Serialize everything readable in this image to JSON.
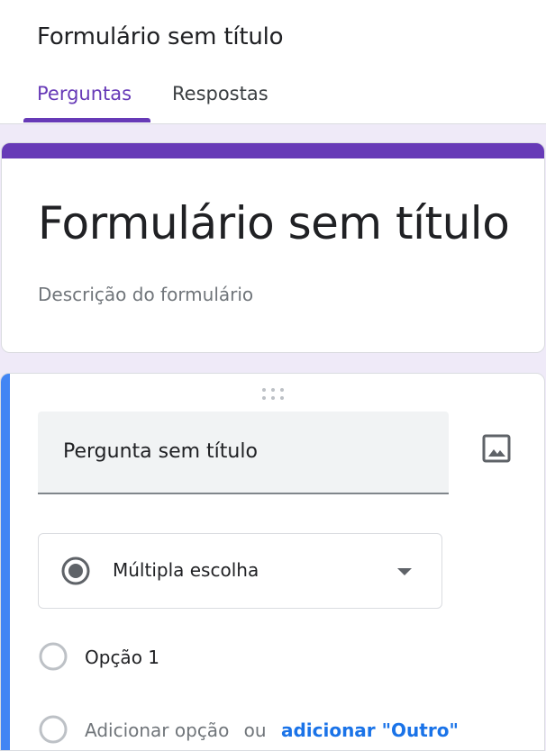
{
  "app": {
    "title": "Formulário sem título"
  },
  "tabs": [
    {
      "label": "Perguntas",
      "active": true
    },
    {
      "label": "Respostas",
      "active": false
    }
  ],
  "form": {
    "title": "Formulário sem título",
    "description": "Descrição do formulário"
  },
  "question": {
    "title": "Pergunta sem título",
    "type": "Múltipla escolha",
    "options": [
      "Opção 1"
    ],
    "add_option": "Adicionar opção",
    "or": "ou",
    "add_other": "adicionar \"Outro\""
  },
  "colors": {
    "accent": "#673ab7",
    "question_accent": "#4285f4",
    "link": "#1a73e8",
    "background": "#efeaf8"
  },
  "icons": {
    "image": "image-icon",
    "drag": "drag-handle-icon",
    "type": "radio-button-checked-icon",
    "dropdown": "arrow-drop-down-icon"
  }
}
